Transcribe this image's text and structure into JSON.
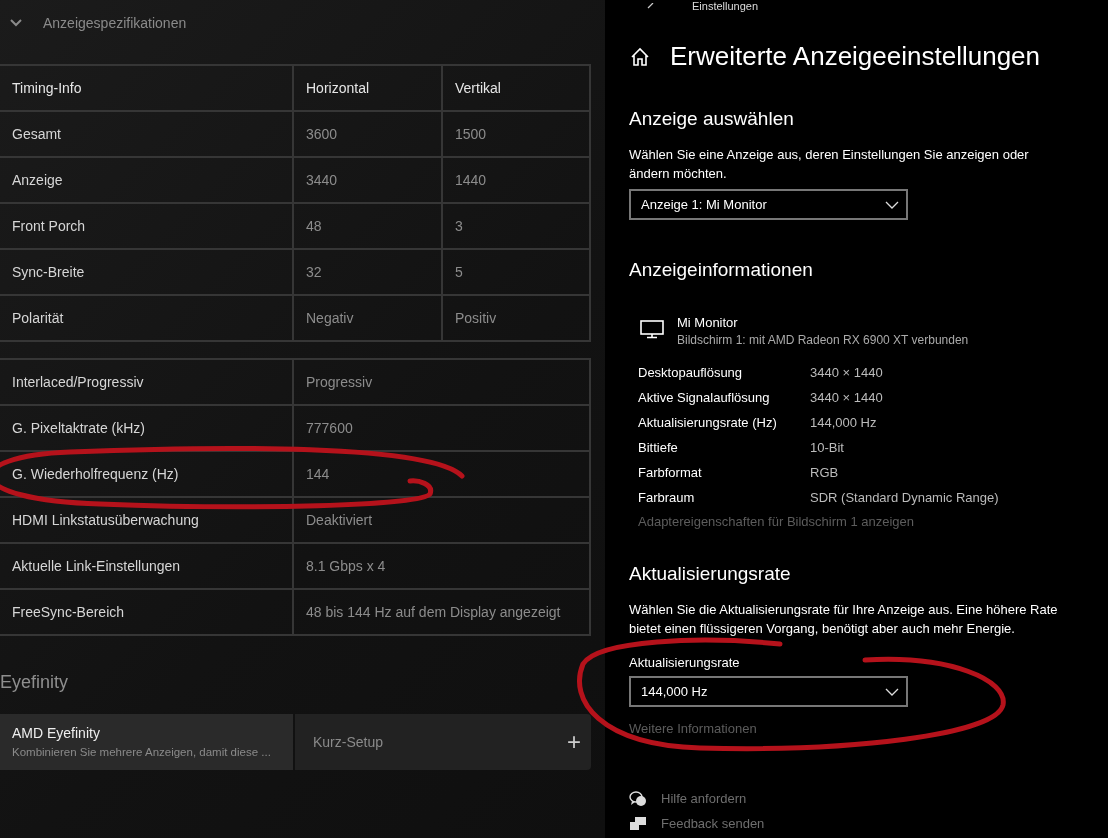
{
  "left": {
    "section": {
      "title": "Anzeigespezifikationen",
      "expanded": true
    },
    "timing_table": {
      "columns": [
        "Timing-Info",
        "Horizontal",
        "Vertikal"
      ],
      "rows": [
        [
          "Gesamt",
          "3600",
          "1500"
        ],
        [
          "Anzeige",
          "3440",
          "1440"
        ],
        [
          "Front Porch",
          "48",
          "3"
        ],
        [
          "Sync-Breite",
          "32",
          "5"
        ],
        [
          "Polarität",
          "Negativ",
          "Positiv"
        ]
      ]
    },
    "info_table": {
      "rows": [
        [
          "Interlaced/Progressiv",
          "Progressiv"
        ],
        [
          "G. Pixeltaktrate (kHz)",
          "777600"
        ],
        [
          "G. Wiederholfrequenz (Hz)",
          "144"
        ],
        [
          "HDMI Linkstatusüberwachung",
          "Deaktiviert"
        ],
        [
          "Aktuelle Link-Einstellungen",
          "8.1 Gbps x 4"
        ],
        [
          "FreeSync-Bereich",
          "48 bis 144 Hz auf dem Display angezeigt"
        ]
      ]
    },
    "eyefinity": {
      "heading": "Eyefinity",
      "card": {
        "title": "AMD Eyefinity",
        "description": "Kombinieren Sie mehrere Anzeigen, damit diese ...",
        "action": "Kurz-Setup",
        "action_icon": "+"
      }
    }
  },
  "right": {
    "breadcrumb": "Einstellungen",
    "title": "Erweiterte Anzeigeeinstellungen",
    "select_display": {
      "heading": "Anzeige auswählen",
      "description": "Wählen Sie eine Anzeige aus, deren Einstellungen Sie anzeigen oder ändern möchten.",
      "dropdown": "Anzeige 1: Mi Monitor"
    },
    "display_info": {
      "heading": "Anzeigeinformationen",
      "monitor_name": "Mi Monitor",
      "monitor_detail": "Bildschirm 1: mit AMD Radeon RX 6900 XT verbunden",
      "rows": [
        {
          "label": "Desktopauflösung",
          "value": "3440 × 1440"
        },
        {
          "label": "Aktive Signalauflösung",
          "value": "3440 × 1440"
        },
        {
          "label": "Aktualisierungsrate (Hz)",
          "value": "144,000 Hz"
        },
        {
          "label": "Bittiefe",
          "value": "10-Bit"
        },
        {
          "label": "Farbformat",
          "value": "RGB"
        },
        {
          "label": "Farbraum",
          "value": "SDR (Standard Dynamic Range)"
        }
      ],
      "link": "Adaptereigenschaften für Bildschirm 1 anzeigen"
    },
    "refresh": {
      "heading": "Aktualisierungsrate",
      "description": "Wählen Sie die Aktualisierungsrate für Ihre Anzeige aus. Eine höhere Rate bietet einen flüssigeren Vorgang, benötigt aber auch mehr Energie.",
      "label": "Aktualisierungsrate",
      "dropdown": "144,000 Hz",
      "link": "Weitere Informationen"
    },
    "help_links": [
      {
        "kind": "help",
        "label": "Hilfe anfordern"
      },
      {
        "kind": "feedback",
        "label": "Feedback senden"
      }
    ]
  }
}
